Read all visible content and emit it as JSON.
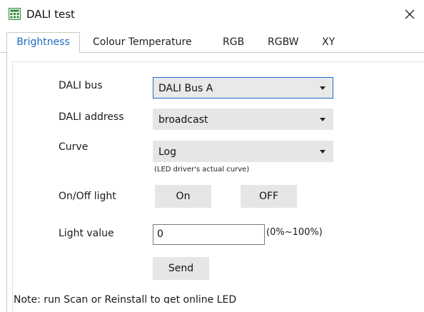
{
  "window": {
    "title": "DALI test",
    "icon": "grid-app-icon",
    "close_icon": "close-icon"
  },
  "tabs": [
    {
      "label": "Brightness",
      "active": true
    },
    {
      "label": "Colour Temperature",
      "active": false
    },
    {
      "label": "RGB",
      "active": false
    },
    {
      "label": "RGBW",
      "active": false
    },
    {
      "label": "XY",
      "active": false
    }
  ],
  "form": {
    "bus_label": "DALI bus",
    "bus_value": "DALI Bus A",
    "address_label": "DALI address",
    "address_value": "broadcast",
    "curve_label": "Curve",
    "curve_value": "Log",
    "curve_hint": "(LED driver's actual curve)",
    "onoff_label": "On/Off light",
    "on_button": "On",
    "off_button": "OFF",
    "light_label": "Light value",
    "light_value": "0",
    "light_unit": "(0%~100%)",
    "send_button": "Send"
  },
  "note": "Note: run Scan or Reinstall to get online LED",
  "colors": {
    "accent": "#1a6bbf",
    "focus_border": "#1f6bd2",
    "button_bg": "#e6e6e6",
    "icon_green": "#2f8a3a"
  }
}
